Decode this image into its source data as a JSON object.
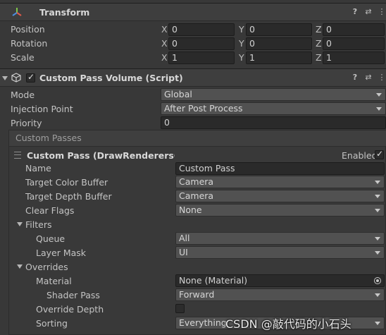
{
  "transform": {
    "title": "Transform",
    "rows": [
      {
        "label": "Position",
        "x": "0",
        "y": "0",
        "z": "0"
      },
      {
        "label": "Rotation",
        "x": "0",
        "y": "0",
        "z": "0"
      },
      {
        "label": "Scale",
        "x": "1",
        "y": "1",
        "z": "1"
      }
    ],
    "axes": {
      "x": "X",
      "y": "Y",
      "z": "Z"
    }
  },
  "custom_pass_volume": {
    "title": "Custom Pass Volume (Script)",
    "mode_label": "Mode",
    "mode_value": "Global",
    "injection_label": "Injection Point",
    "injection_value": "After Post Process",
    "priority_label": "Priority",
    "priority_value": "0",
    "custom_passes_label": "Custom Passes",
    "pass": {
      "title": "Custom Pass (DrawRenderersCusto",
      "enabled_label": "Enabled",
      "name_label": "Name",
      "name_value": "Custom Pass",
      "target_color_label": "Target Color Buffer",
      "target_color_value": "Camera",
      "target_depth_label": "Target Depth Buffer",
      "target_depth_value": "Camera",
      "clear_flags_label": "Clear Flags",
      "clear_flags_value": "None",
      "filters_label": "Filters",
      "queue_label": "Queue",
      "queue_value": "All",
      "layer_mask_label": "Layer Mask",
      "layer_mask_value": "UI",
      "overrides_label": "Overrides",
      "material_label": "Material",
      "material_value": "None (Material)",
      "shader_pass_label": "Shader Pass",
      "shader_pass_value": "Forward",
      "override_depth_label": "Override Depth",
      "sorting_label": "Sorting",
      "sorting_value": "Everything"
    }
  },
  "watermark": "CSDN @敲代码的小石头",
  "header_icons": {
    "help": "?",
    "presets": "⇄",
    "menu": "⋮"
  }
}
